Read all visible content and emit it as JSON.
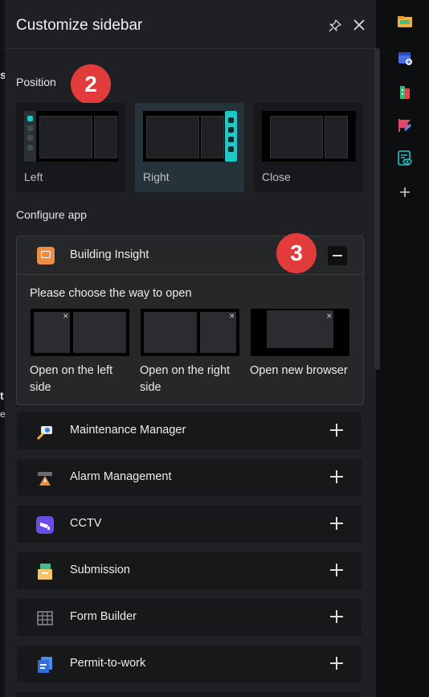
{
  "panel": {
    "title": "Customize sidebar"
  },
  "position": {
    "label": "Position",
    "badge": "2",
    "options": [
      {
        "label": "Left",
        "selected": false
      },
      {
        "label": "Right",
        "selected": true
      },
      {
        "label": "Close",
        "selected": false
      }
    ]
  },
  "configure": {
    "label": "Configure app",
    "badge": "3",
    "expanded_app": {
      "name": "Building Insight",
      "prompt": "Please choose the way to open",
      "open_options": [
        {
          "label": "Open on the left side"
        },
        {
          "label": "Open on the right side"
        },
        {
          "label": "Open new browser"
        }
      ]
    },
    "apps": [
      {
        "name": "Maintenance Manager"
      },
      {
        "name": "Alarm Management"
      },
      {
        "name": "CCTV"
      },
      {
        "name": "Submission"
      },
      {
        "name": "Form Builder"
      },
      {
        "name": "Permit-to-work"
      }
    ]
  },
  "background_fragments": [
    "s",
    "t",
    "e"
  ],
  "colors": {
    "accent": "#1fc7c7",
    "badge": "#e23b3b",
    "panel_bg": "#1f2023"
  },
  "right_rail_icons": [
    "folder-icon",
    "calendar-add-icon",
    "building-icon",
    "flag-icon",
    "report-view-icon",
    "add-icon"
  ]
}
